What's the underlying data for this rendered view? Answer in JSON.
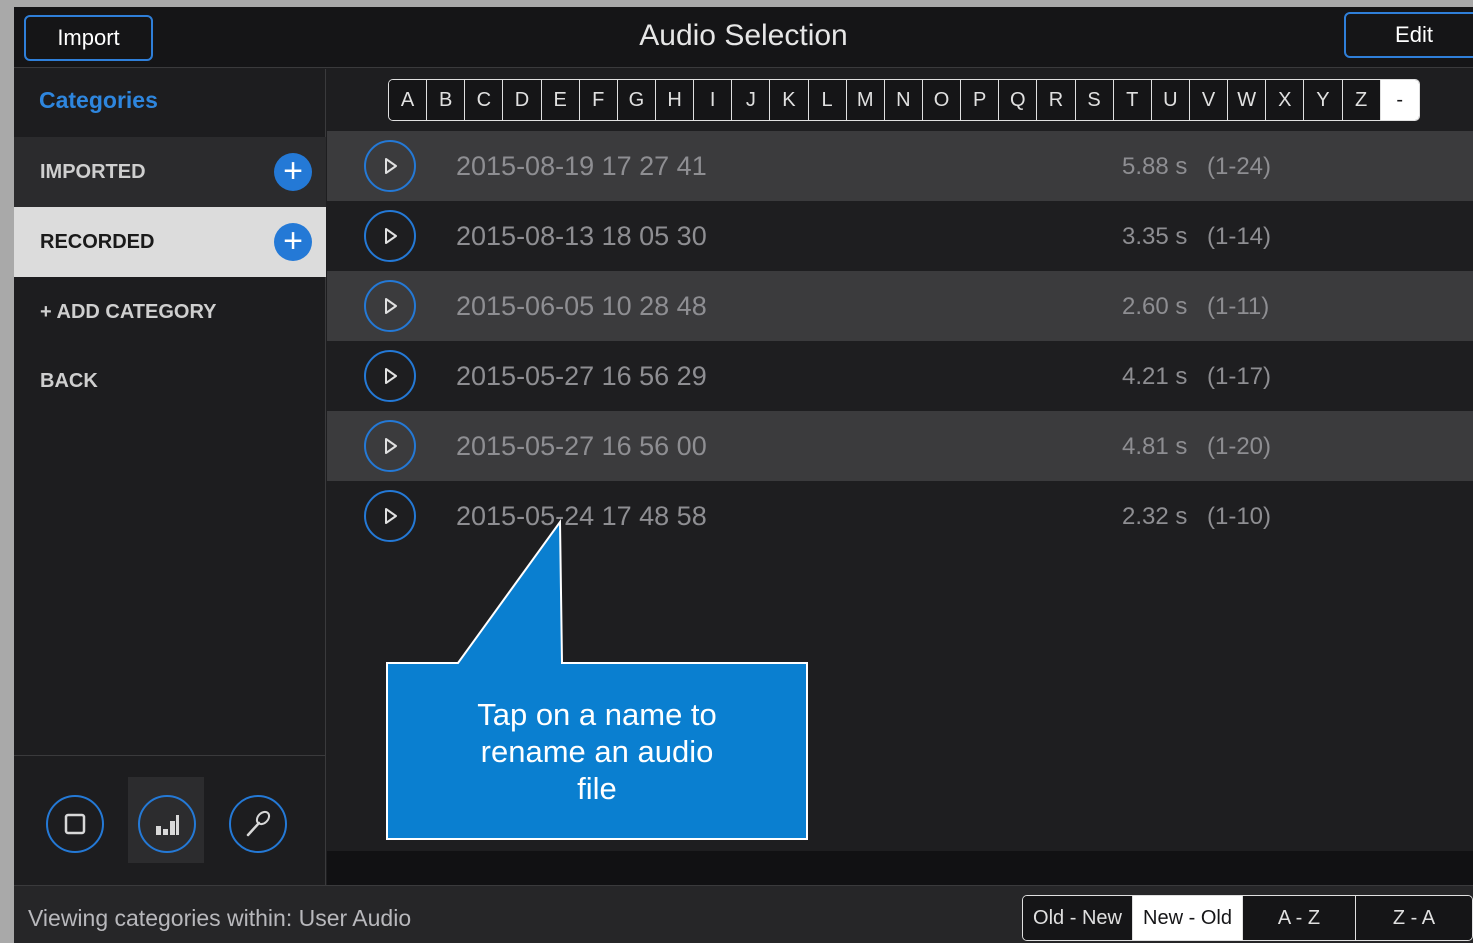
{
  "header": {
    "title": "Audio Selection",
    "import_label": "Import",
    "edit_label": "Edit"
  },
  "sidebar": {
    "title": "Categories",
    "items": [
      {
        "label": "IMPORTED",
        "has_add": true,
        "selected": false
      },
      {
        "label": "RECORDED",
        "has_add": true,
        "selected": true
      },
      {
        "label": "+ ADD CATEGORY",
        "has_add": false,
        "selected": false
      },
      {
        "label": "BACK",
        "has_add": false,
        "selected": false
      }
    ],
    "tools": [
      "stop-icon",
      "levels-icon",
      "microphone-icon"
    ]
  },
  "alphabet": [
    "A",
    "B",
    "C",
    "D",
    "E",
    "F",
    "G",
    "H",
    "I",
    "J",
    "K",
    "L",
    "M",
    "N",
    "O",
    "P",
    "Q",
    "R",
    "S",
    "T",
    "U",
    "V",
    "W",
    "X",
    "Y",
    "Z",
    "-"
  ],
  "alphabet_active": "-",
  "files": [
    {
      "name": "2015-08-19 17 27 41",
      "duration": "5.88 s",
      "range": "(1-24)"
    },
    {
      "name": "2015-08-13 18 05 30",
      "duration": "3.35 s",
      "range": "(1-14)"
    },
    {
      "name": "2015-06-05 10 28 48",
      "duration": "2.60 s",
      "range": "(1-11)"
    },
    {
      "name": "2015-05-27 16 56 29",
      "duration": "4.21 s",
      "range": "(1-17)"
    },
    {
      "name": "2015-05-27 16 56 00",
      "duration": "4.81 s",
      "range": "(1-20)"
    },
    {
      "name": "2015-05-24 17 48 58",
      "duration": "2.32 s",
      "range": "(1-10)"
    }
  ],
  "callout": {
    "text": "Tap on a name to rename an audio file"
  },
  "footer": {
    "status": "Viewing categories within: User Audio",
    "sort_options": [
      "Old - New",
      "New - Old",
      "A - Z",
      "Z - A"
    ],
    "sort_active": "New - Old"
  },
  "colors": {
    "accent": "#2479d6",
    "callout": "#0a7fd0"
  }
}
